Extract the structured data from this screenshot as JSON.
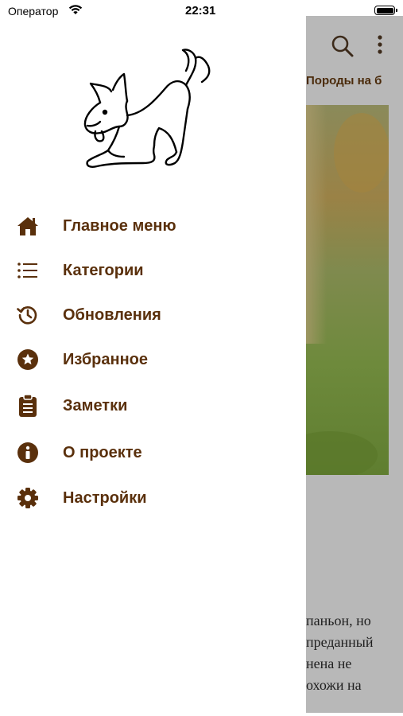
{
  "status": {
    "carrier": "Оператор",
    "time": "22:31"
  },
  "drawer": {
    "items": [
      {
        "label": "Главное меню",
        "icon": "home-icon"
      },
      {
        "label": "Категории",
        "icon": "list-icon"
      },
      {
        "label": "Обновления",
        "icon": "history-icon"
      },
      {
        "label": "Избранное",
        "icon": "star-icon"
      },
      {
        "label": "Заметки",
        "icon": "clipboard-icon"
      },
      {
        "label": "О проекте",
        "icon": "info-icon"
      },
      {
        "label": "Настройки",
        "icon": "gear-icon"
      }
    ]
  },
  "background_screen": {
    "title_fragment": "Породы на б",
    "text_lines": [
      "паньон, но",
      "преданный",
      "нена не",
      "охожи на"
    ]
  },
  "colors": {
    "accent": "#5a300c",
    "dim_overlay": "#b8b8b8"
  }
}
